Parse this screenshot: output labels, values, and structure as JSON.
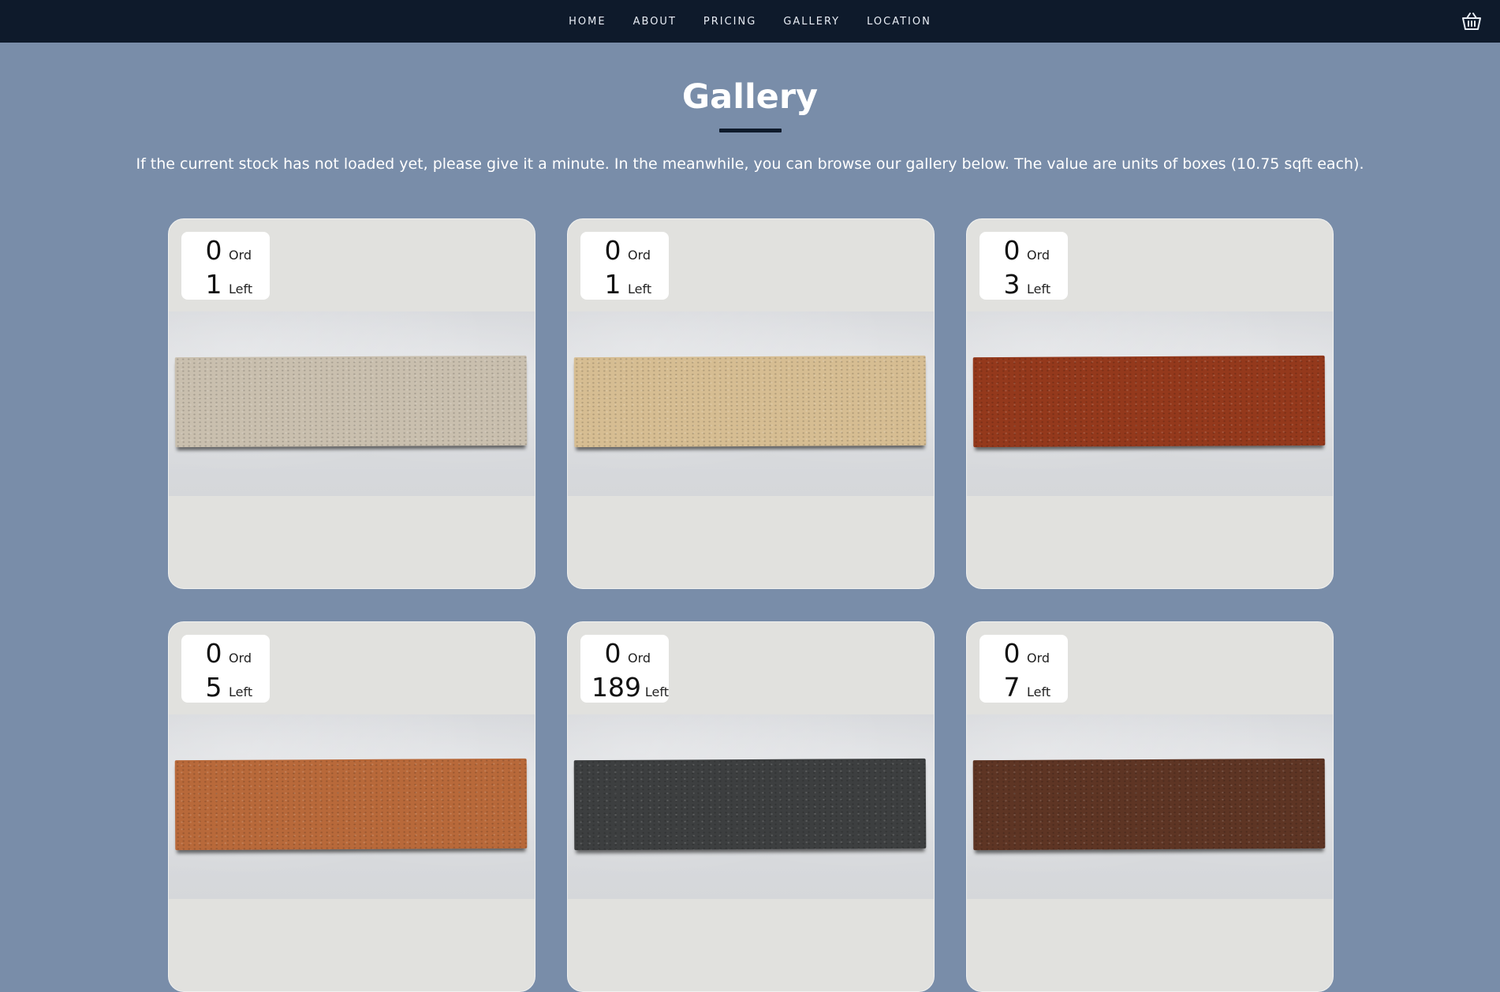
{
  "nav": {
    "links": [
      "HOME",
      "ABOUT",
      "PRICING",
      "GALLERY",
      "LOCATION"
    ],
    "cart_icon": "basket-icon"
  },
  "header": {
    "title": "Gallery",
    "subtitle": "If the current stock has not loaded yet, please give it a minute. In the meanwhile, you can browse our gallery below. The value are units of boxes (10.75 sqft each)."
  },
  "stock_labels": {
    "ordered": "Ord",
    "left": "Left"
  },
  "products": [
    {
      "ordered": "0",
      "left": "1",
      "brick_color": "#c9bfae"
    },
    {
      "ordered": "0",
      "left": "1",
      "brick_color": "#d6bd92"
    },
    {
      "ordered": "0",
      "left": "3",
      "brick_color": "#94391c"
    },
    {
      "ordered": "0",
      "left": "5",
      "brick_color": "#b8693a"
    },
    {
      "ordered": "0",
      "left": "189",
      "brick_color": "#3d3f40"
    },
    {
      "ordered": "0",
      "left": "7",
      "brick_color": "#5e3524"
    }
  ],
  "colors": {
    "page_background": "#798da9",
    "nav_background": "#0e1a2b",
    "card_background": "#e1e1de"
  }
}
